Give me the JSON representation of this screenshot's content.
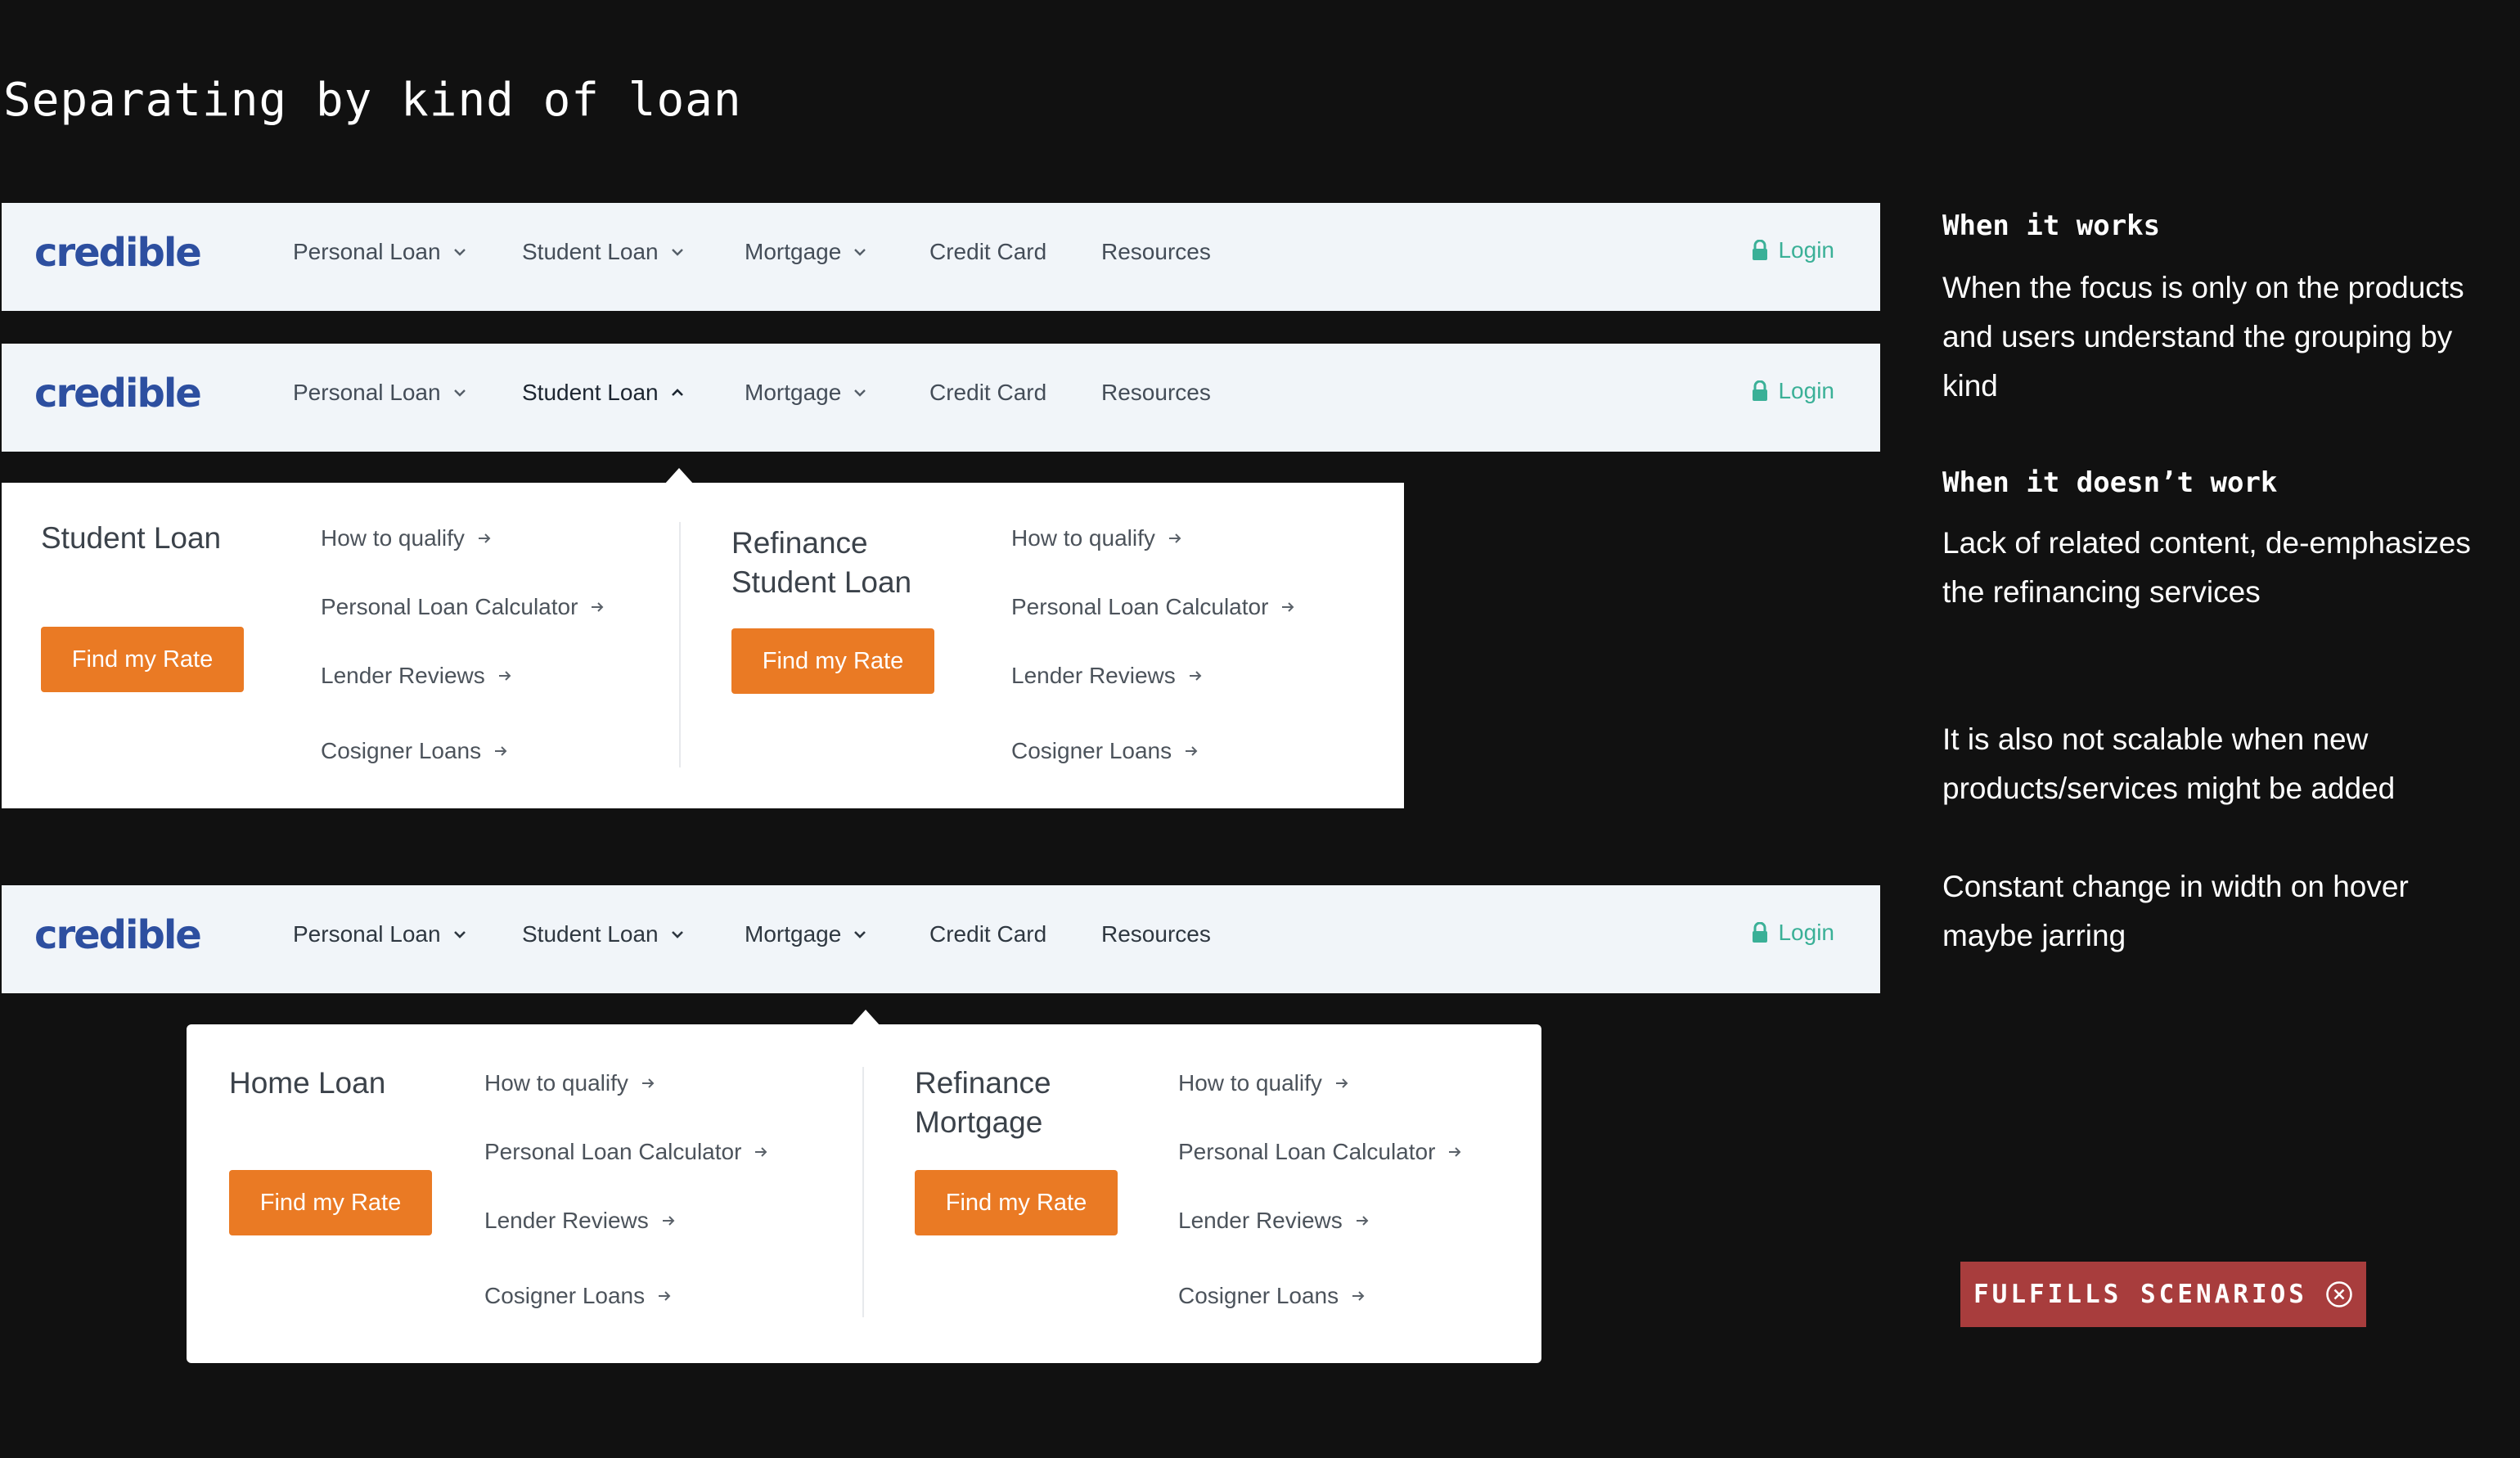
{
  "page": {
    "title": "Separating by kind of loan"
  },
  "nav": {
    "logo": "credible",
    "items": [
      "Personal Loan",
      "Student Loan",
      "Mortgage",
      "Credit Card",
      "Resources"
    ],
    "login": "Login"
  },
  "student_dropdown": {
    "groups": [
      {
        "title": "Student Loan",
        "button": "Find my Rate",
        "links": [
          "How to qualify",
          "Personal Loan Calculator",
          "Lender Reviews",
          "Cosigner Loans"
        ]
      },
      {
        "title": "Refinance Student Loan",
        "button": "Find my Rate",
        "links": [
          "How to qualify",
          "Personal Loan Calculator",
          "Lender Reviews",
          "Cosigner Loans"
        ]
      }
    ]
  },
  "mortgage_dropdown": {
    "groups": [
      {
        "title": "Home Loan",
        "button": "Find my Rate",
        "links": [
          "How to qualify",
          "Personal Loan Calculator",
          "Lender Reviews",
          "Cosigner Loans"
        ]
      },
      {
        "title": "Refinance Mortgage",
        "button": "Find my Rate",
        "links": [
          "How to qualify",
          "Personal Loan Calculator",
          "Lender Reviews",
          "Cosigner Loans"
        ]
      }
    ]
  },
  "notes": {
    "works_heading": "When it works",
    "works_text": "When the focus is only on the products and users understand the grouping by kind",
    "doesnt_heading": "When it doesn’t work",
    "doesnt_items": [
      "Lack of related content, de-emphasizes the refinancing services",
      "It is also not scalable when new products/services might be added",
      "Constant change in width on hover maybe jarring"
    ]
  },
  "badge": {
    "label": "FULFILLS SCENARIOS",
    "icon": "circle-x-icon"
  },
  "colors": {
    "accent": "#ea7a24",
    "brand": "#2d4fa0",
    "login": "#3ab097",
    "badge": "#a83d3d",
    "navbar_bg": "#f1f5f9"
  }
}
